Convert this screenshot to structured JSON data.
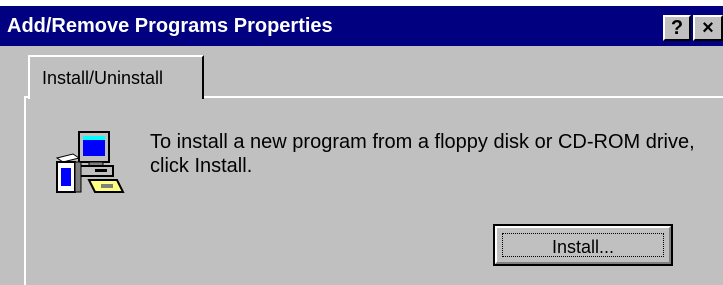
{
  "window": {
    "title": "Add/Remove Programs Properties",
    "help_button": "?",
    "close_button": "×"
  },
  "tabs": [
    {
      "label": "Install/Uninstall",
      "selected": true
    }
  ],
  "install_panel": {
    "icon": "install-program-icon",
    "message": "To install a new program from a floppy disk or CD-ROM drive, click Install.",
    "install_button": "Install..."
  },
  "colors": {
    "titlebar": "#000080",
    "title_text": "#ffffff",
    "face": "#c0c0c0"
  }
}
